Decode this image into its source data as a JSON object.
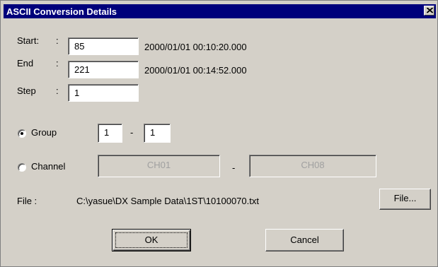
{
  "window": {
    "title": "ASCII Conversion Details"
  },
  "range": {
    "start_label": "Start:",
    "start_colon": ":",
    "start_value": "85",
    "start_time": "2000/01/01 00:10:20.000",
    "end_label": "End",
    "end_colon": ":",
    "end_value": "221",
    "end_time": "2000/01/01 00:14:52.000",
    "step_label": "Step",
    "step_colon": ":",
    "step_value": "1"
  },
  "selection": {
    "group_label": "Group",
    "group_selected": true,
    "group_from": "1",
    "group_dash": "-",
    "group_to": "1",
    "channel_label": "Channel",
    "channel_selected": false,
    "channel_from": "CH01",
    "channel_dash": "-",
    "channel_to": "CH08"
  },
  "file": {
    "label": "File :",
    "path": "C:\\yasue\\DX Sample Data\\1ST\\10100070.txt",
    "browse_label": "File..."
  },
  "buttons": {
    "ok_label": "OK",
    "cancel_label": "Cancel"
  }
}
